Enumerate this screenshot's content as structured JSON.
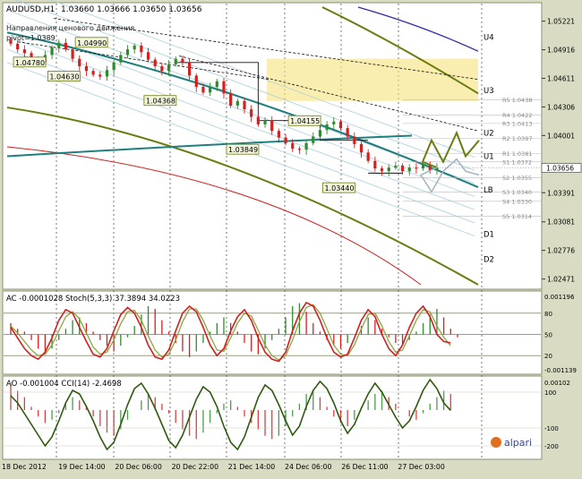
{
  "colors": {
    "bg": "#d9dcc3",
    "plot_bg": "#ffffff",
    "grid": "#9aa28a",
    "bull": "#2e8b2e",
    "bear": "#d61f1f",
    "olive": "#6b7d10",
    "teal": "#1f7f7f",
    "red_ma": "#d02020",
    "navy": "#2a2aa8",
    "band": "#a9cfe0",
    "zone": "#f5e27a",
    "label_bg": "#f3f5dc",
    "projection_gray": "#9fb5bd"
  },
  "header": {
    "symbol": "AUDUSD,H1",
    "ohlc": "1.03660 1.03666 1.03650 1.03656",
    "caption": "Направления ценового движения",
    "pivot": "pivot=1.0389"
  },
  "chart_data": [
    {
      "type": "candlestick",
      "panel": "price",
      "ylim": [
        1.0241,
        1.0537
      ],
      "y_ticks": [
        "1.05221",
        "1.04916",
        "1.04611",
        "1.04306",
        "1.04001",
        "1.03391",
        "1.03081",
        "1.02776",
        "1.02471"
      ],
      "x_time_labels": [
        "18 Dec 2012",
        "19 Dec 14:00",
        "20 Dec 06:00",
        "20 Dec 22:00",
        "21 Dec 14:00",
        "24 Dec 06:00",
        "26 Dec 11:00",
        "27 Dec 03:00"
      ],
      "current_price": "1.03656",
      "level_labels": [
        {
          "name": "U4",
          "price": 1.0505
        },
        {
          "name": "U3",
          "price": 1.0448
        },
        {
          "name": "U2",
          "price": 1.0403
        },
        {
          "name": "U1",
          "price": 1.0378
        },
        {
          "name": "LB",
          "price": 1.0342
        },
        {
          "name": "D1",
          "price": 1.0295
        },
        {
          "name": "D2",
          "price": 1.0268
        }
      ],
      "pivot_levels": [
        {
          "label": "R5 1.0438",
          "price": 1.0438
        },
        {
          "label": "R4 1.0422",
          "price": 1.0422
        },
        {
          "label": "R3 1.0413",
          "price": 1.0413
        },
        {
          "label": "R2 1.0397",
          "price": 1.0397
        },
        {
          "label": "R1 1.0381",
          "price": 1.0381
        },
        {
          "label": "S1 1.0372",
          "price": 1.0372
        },
        {
          "label": "S2 1.0355",
          "price": 1.0355
        },
        {
          "label": "S3 1.0340",
          "price": 1.034
        },
        {
          "label": "S4 1.0330",
          "price": 1.033
        },
        {
          "label": "S5 1.0314",
          "price": 1.0314
        }
      ],
      "annotations": [
        {
          "text": "1.04780",
          "bar": 3,
          "price": 1.0478
        },
        {
          "text": "1.04990",
          "bar": 12,
          "price": 1.0499
        },
        {
          "text": "1.04630",
          "bar": 8,
          "price": 1.0463
        },
        {
          "text": "1.04368",
          "bar": 22,
          "price": 1.0437
        },
        {
          "text": "1.04155",
          "bar": 43,
          "price": 1.04155
        },
        {
          "text": "1.03849",
          "bar": 34,
          "price": 1.0385
        },
        {
          "text": "1.03440",
          "bar": 48,
          "price": 1.0344
        }
      ],
      "closes": [
        1.0498,
        1.0492,
        1.0488,
        1.0481,
        1.0478,
        1.0486,
        1.0494,
        1.0499,
        1.0492,
        1.0482,
        1.0474,
        1.0469,
        1.0465,
        1.0463,
        1.047,
        1.0478,
        1.0486,
        1.0492,
        1.0496,
        1.0489,
        1.0481,
        1.0474,
        1.0469,
        1.0476,
        1.0482,
        1.0478,
        1.0464,
        1.0452,
        1.0446,
        1.0452,
        1.0458,
        1.0445,
        1.0432,
        1.0437,
        1.0428,
        1.042,
        1.0412,
        1.0416,
        1.0405,
        1.0398,
        1.0392,
        1.0386,
        1.0385,
        1.0392,
        1.0399,
        1.0406,
        1.0412,
        1.0415,
        1.0408,
        1.0399,
        1.0391,
        1.0382,
        1.0373,
        1.0365,
        1.0362,
        1.0366,
        1.0368,
        1.0362,
        1.0366,
        1.0365,
        1.0369,
        1.0363,
        1.0366
      ]
    },
    {
      "type": "oscillator",
      "panel": "ac_stoch",
      "title": "AC -0.0001028  Stoch(5,3,3) 37.3894 34.0223",
      "y_ticks": [
        "0.001196",
        "80",
        "50",
        "20",
        "-0.001139"
      ],
      "ac_values": [
        0.0004,
        0.0002,
        0.0001,
        -0.0002,
        -0.0005,
        -0.0007,
        -0.0005,
        -0.0002,
        0.0002,
        0.0005,
        0.0006,
        0.0004,
        0.0001,
        -0.0002,
        -0.0004,
        -0.0006,
        -0.0004,
        -0.0001,
        0.0003,
        0.0007,
        0.001,
        0.0009,
        0.0005,
        0.0001,
        -0.0003,
        -0.0006,
        -0.0008,
        -0.0006,
        -0.0003,
        0.0001,
        0.0004,
        0.0006,
        0.0004,
        0.0001,
        -0.0003,
        -0.0006,
        -0.0007,
        -0.0005,
        -0.0002,
        0.0002,
        0.0006,
        0.001,
        0.0011,
        0.0008,
        0.0004,
        0.0001,
        -0.0002,
        -0.0004,
        -0.0005,
        -0.0003,
        0.0,
        0.0003,
        0.0006,
        0.0005,
        0.0002,
        -0.0001,
        -0.0003,
        -0.0004,
        -0.0002,
        0.0001,
        0.0004,
        0.0007,
        0.0009,
        0.0006,
        0.0002,
        -0.0001
      ],
      "stoch_main": [
        60,
        45,
        30,
        20,
        15,
        25,
        45,
        70,
        85,
        80,
        60,
        40,
        22,
        18,
        30,
        55,
        78,
        88,
        80,
        60,
        35,
        18,
        15,
        28,
        55,
        80,
        90,
        82,
        60,
        35,
        20,
        30,
        55,
        75,
        85,
        70,
        45,
        25,
        15,
        12,
        25,
        55,
        80,
        95,
        90,
        70,
        45,
        25,
        18,
        22,
        45,
        70,
        85,
        75,
        50,
        30,
        20,
        35,
        60,
        80,
        90,
        75,
        50,
        40,
        38
      ],
      "stoch_signal": [
        62,
        52,
        40,
        28,
        20,
        22,
        35,
        55,
        75,
        82,
        72,
        52,
        32,
        22,
        25,
        42,
        65,
        82,
        84,
        70,
        48,
        28,
        18,
        22,
        42,
        68,
        86,
        86,
        70,
        48,
        28,
        26,
        45,
        66,
        80,
        76,
        56,
        35,
        20,
        14,
        20,
        42,
        68,
        88,
        92,
        80,
        58,
        35,
        22,
        20,
        35,
        58,
        78,
        80,
        62,
        40,
        25,
        28,
        48,
        70,
        85,
        82,
        62,
        46,
        34
      ]
    },
    {
      "type": "oscillator",
      "panel": "ao_cci",
      "title": "AO -0.001004  CCI(14) -2.4698",
      "y_ticks": [
        "0.00102",
        "100",
        "-100",
        "-200"
      ],
      "ao_values": [
        0.0008,
        0.0006,
        0.0004,
        0.0001,
        -0.0002,
        -0.0004,
        -0.0003,
        -0.0001,
        0.0002,
        0.0004,
        0.0003,
        0.0001,
        -0.0002,
        -0.0005,
        -0.0007,
        -0.0008,
        -0.0006,
        -0.0003,
        0.0,
        0.0003,
        0.0005,
        0.0004,
        0.0002,
        -0.0001,
        -0.0004,
        -0.0006,
        -0.0008,
        -0.0009,
        -0.0007,
        -0.0004,
        -0.0001,
        0.0002,
        0.0003,
        0.0001,
        -0.0002,
        -0.0004,
        -0.0006,
        -0.0008,
        -0.0009,
        -0.0008,
        -0.0005,
        -0.0002,
        0.0002,
        0.0005,
        0.0006,
        0.0004,
        0.0001,
        -0.0002,
        -0.0004,
        -0.0005,
        -0.0003,
        0.0,
        0.0003,
        0.0005,
        0.0006,
        0.0004,
        0.0002,
        0.0,
        -0.0002,
        -0.0003,
        -0.0001,
        0.0002,
        0.0004,
        0.0006,
        0.0005
      ],
      "cci_values": [
        80,
        40,
        -20,
        -80,
        -140,
        -200,
        -150,
        -60,
        40,
        110,
        90,
        20,
        -60,
        -150,
        -220,
        -180,
        -80,
        30,
        120,
        150,
        90,
        10,
        -80,
        -170,
        -210,
        -140,
        -40,
        60,
        130,
        100,
        20,
        -90,
        -180,
        -220,
        -150,
        -40,
        70,
        140,
        110,
        30,
        -60,
        -140,
        -90,
        20,
        110,
        160,
        120,
        40,
        -60,
        -130,
        -80,
        10,
        90,
        150,
        100,
        30,
        -40,
        -100,
        -60,
        20,
        110,
        170,
        120,
        40,
        -2
      ]
    }
  ]
}
